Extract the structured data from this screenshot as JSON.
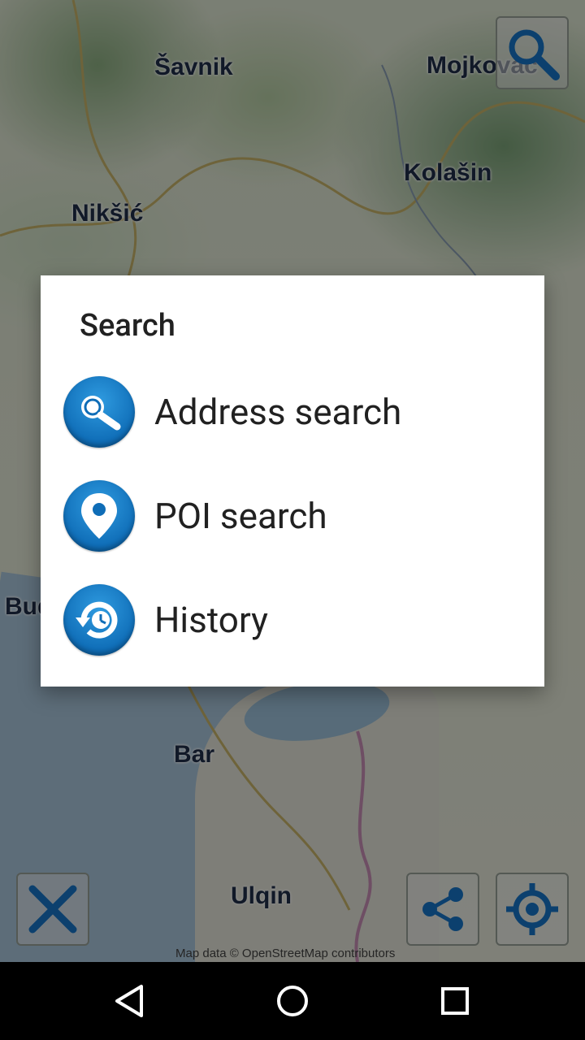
{
  "map": {
    "cities": [
      {
        "name": "Šavnik"
      },
      {
        "name": "Mojkovac"
      },
      {
        "name": "Kolašin"
      },
      {
        "name": "Nikšić"
      },
      {
        "name": "Bar"
      },
      {
        "name": "Ulqin"
      },
      {
        "name": "Bud"
      }
    ],
    "attribution": "Map data © OpenStreetMap contributors",
    "buttons": {
      "search": "search-icon",
      "measure": "ruler-pencil-icon",
      "share": "share-icon",
      "locate": "crosshair-icon"
    }
  },
  "dialog": {
    "title": "Search",
    "items": [
      {
        "label": "Address search",
        "icon": "magnifier-icon"
      },
      {
        "label": "POI search",
        "icon": "map-pin-icon"
      },
      {
        "label": "History",
        "icon": "history-clock-icon"
      }
    ]
  },
  "navbar": {
    "back": "back-triangle-icon",
    "home": "home-circle-icon",
    "recents": "recents-square-icon"
  },
  "colors": {
    "accent": "#0f6db7",
    "dialog_bg": "#ffffff",
    "text": "#212121"
  }
}
